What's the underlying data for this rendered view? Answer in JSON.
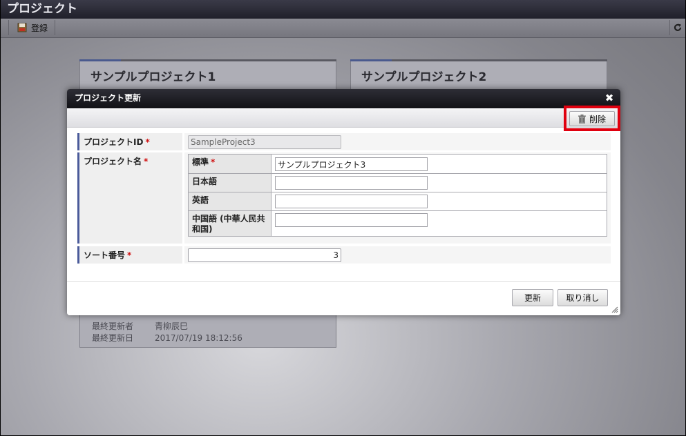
{
  "app": {
    "title": "プロジェクト"
  },
  "toolbar": {
    "register_label": "登録"
  },
  "cards": [
    {
      "title": "サンプルプロジェクト1",
      "meta": [
        {
          "key": "最終更新者",
          "value": "青柳辰巳"
        },
        {
          "key": "最終更新日",
          "value": "2017/07/19 18:12:56"
        }
      ]
    },
    {
      "title": "サンプルプロジェクト2"
    }
  ],
  "dialog": {
    "title": "プロジェクト更新",
    "delete_label": "削除",
    "fields": {
      "project_id": {
        "label": "プロジェクトID",
        "required": "*",
        "value": "SampleProject3"
      },
      "project_name": {
        "label": "プロジェクト名",
        "required": "*",
        "locales": [
          {
            "label": "標準",
            "required": "*",
            "value": "サンプルプロジェクト3"
          },
          {
            "label": "日本語",
            "value": ""
          },
          {
            "label": "英語",
            "value": ""
          },
          {
            "label": "中国語 (中華人民共和国)",
            "value": ""
          }
        ]
      },
      "sort_order": {
        "label": "ソート番号",
        "required": "*",
        "value": "3"
      }
    },
    "update_label": "更新",
    "cancel_label": "取り消し"
  },
  "colors": {
    "required": "#d01010",
    "highlight": "#e0000f",
    "accent": "#4a5a9a"
  }
}
